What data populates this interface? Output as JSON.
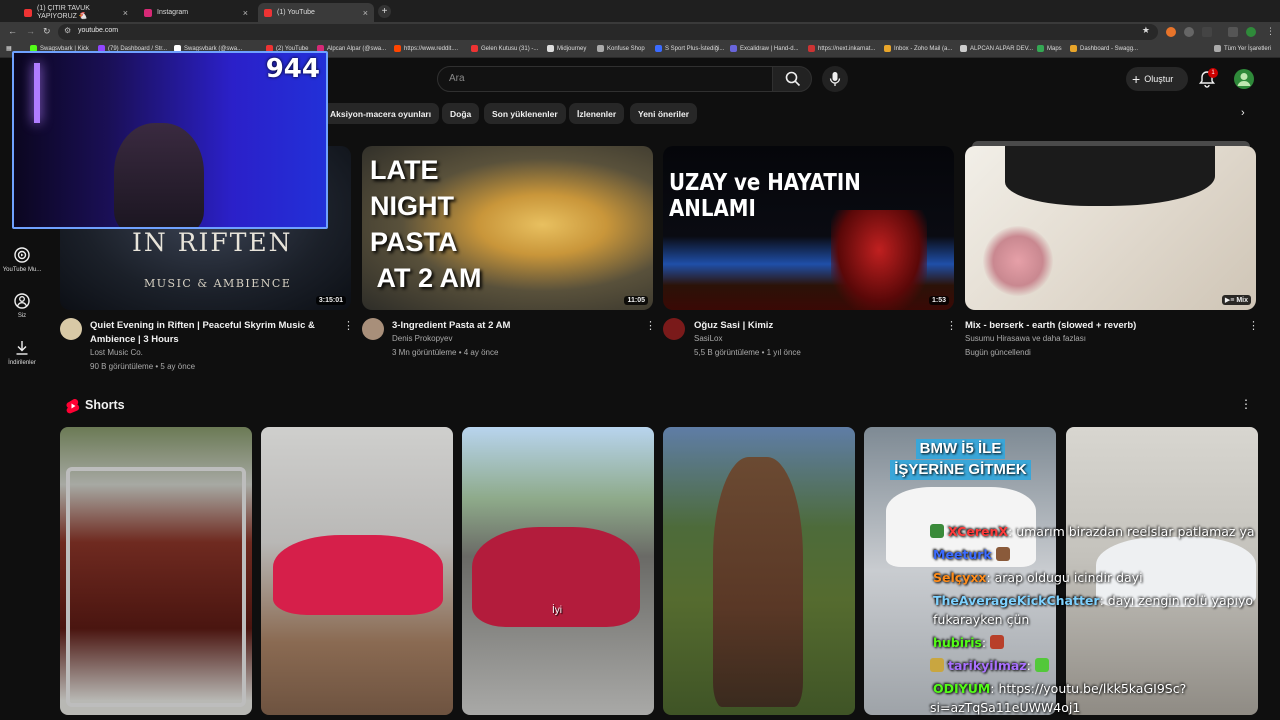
{
  "browser": {
    "tabs": [
      {
        "title": "(1) ÇITIR TAVUK YAPIYORUZ 🐔",
        "close": "×",
        "color": "#e33"
      },
      {
        "title": "Instagram",
        "close": "×",
        "color": "#d62976"
      },
      {
        "title": "(1) YouTube",
        "close": "×",
        "color": "#e33"
      }
    ],
    "new_tab": "+",
    "url": "youtube.com",
    "bookmarks": [
      "Swagsvbark | Kick",
      "(79) Dashboard / Str...",
      "Swagsvbark (@swa...",
      "(2) YouTube",
      "Alpcan Alpar (@swa...",
      "https://www.reddit....",
      "Gelen Kutusu (31) -...",
      "Midjourney",
      "Konfuse Shop",
      "S Sport Plus-İstediği...",
      "Excalidraw | Hand-d...",
      "https://next.inkarnat...",
      "Inbox - Zoho Mail (a...",
      "ALPCAN ALPAR DEV...",
      "Maps",
      "Dashboard - Swagg..."
    ],
    "all_bookmarks": "Tüm Yer İşaretleri"
  },
  "header": {
    "search_placeholder": "Ara",
    "create_label": "Oluştur",
    "notification_count": "1"
  },
  "chips": [
    "Aksiyon-macera oyunları",
    "Doğa",
    "Son yüklenenler",
    "İzlenenler",
    "Yeni öneriler"
  ],
  "sidebar": [
    {
      "label": "YouTube Mu...",
      "icon": "youtube-music-icon"
    },
    {
      "label": "Siz",
      "icon": "you-icon"
    },
    {
      "label": "İndirilenler",
      "icon": "download-icon"
    }
  ],
  "webcam": {
    "counter": "944"
  },
  "videos": [
    {
      "title": "Quiet Evening in Riften | Peaceful Skyrim Music & Ambience | 3 Hours",
      "channel": "Lost Music Co.",
      "meta": "90 B görüntüleme • 5 ay önce",
      "duration": "3:15:01",
      "thumb_title": "IN RIFTEN",
      "thumb_sub": "MUSIC & AMBIENCE"
    },
    {
      "title": "3-Ingredient Pasta at 2 AM",
      "channel": "Denis Prokopyev",
      "meta": "3 Mn görüntüleme • 4 ay önce",
      "duration": "11:05",
      "thumb_lines": [
        "LATE",
        "NIGHT",
        "PASTA",
        " AT 2 AM"
      ]
    },
    {
      "title": "Oğuz Sasi | Kimiz",
      "channel": "SasiLox",
      "meta": "5,5 B görüntüleme • 1 yıl önce",
      "duration": "1:53",
      "thumb_title": "UZAY ve HAYATIN ANLAMI"
    },
    {
      "title": "Mix - berserk - earth (slowed + reverb)",
      "channel": "Susumu Hirasawa ve daha fazlası",
      "meta": "Bugün güncellendi",
      "duration": "Mix"
    }
  ],
  "shorts": {
    "title": "Shorts",
    "items": [
      {
        "caption": ""
      },
      {
        "caption": ""
      },
      {
        "caption": "İyi"
      },
      {
        "caption": ""
      },
      {
        "caption_lines": [
          "BMW İ5 İLE",
          "İŞYERİNE GİTMEK"
        ]
      },
      {
        "caption": ""
      }
    ]
  },
  "chat": [
    {
      "user": "XCerenX",
      "color": "#ff3b3b",
      "text": ": umarım birazdan reelslar patlamaz ya"
    },
    {
      "user": "Meeturk",
      "color": "#3b6bff",
      "text": ""
    },
    {
      "user": "Selçyxx",
      "color": "#ff8c1a",
      "text": ": arap oldugu icindir dayi"
    },
    {
      "user": "TheAverageKickChatter",
      "color": "#7fd2ff",
      "text": ": dayı zengin rolü yapıyo"
    },
    {
      "user": "",
      "color": "#ffffff",
      "text": "fukarayken çün"
    },
    {
      "user": "hubiris",
      "color": "#53fc18",
      "text": ":"
    },
    {
      "user": "tarikyilmaz",
      "color": "#a970ff",
      "text": ":"
    },
    {
      "user": "ODIYUM",
      "color": "#53fc18",
      "text": ": https://youtu.be/lkk5kaGI9Sc?"
    },
    {
      "user": "",
      "color": "#ffffff",
      "text": "si=azTqSa11eUWW4oj1"
    }
  ]
}
